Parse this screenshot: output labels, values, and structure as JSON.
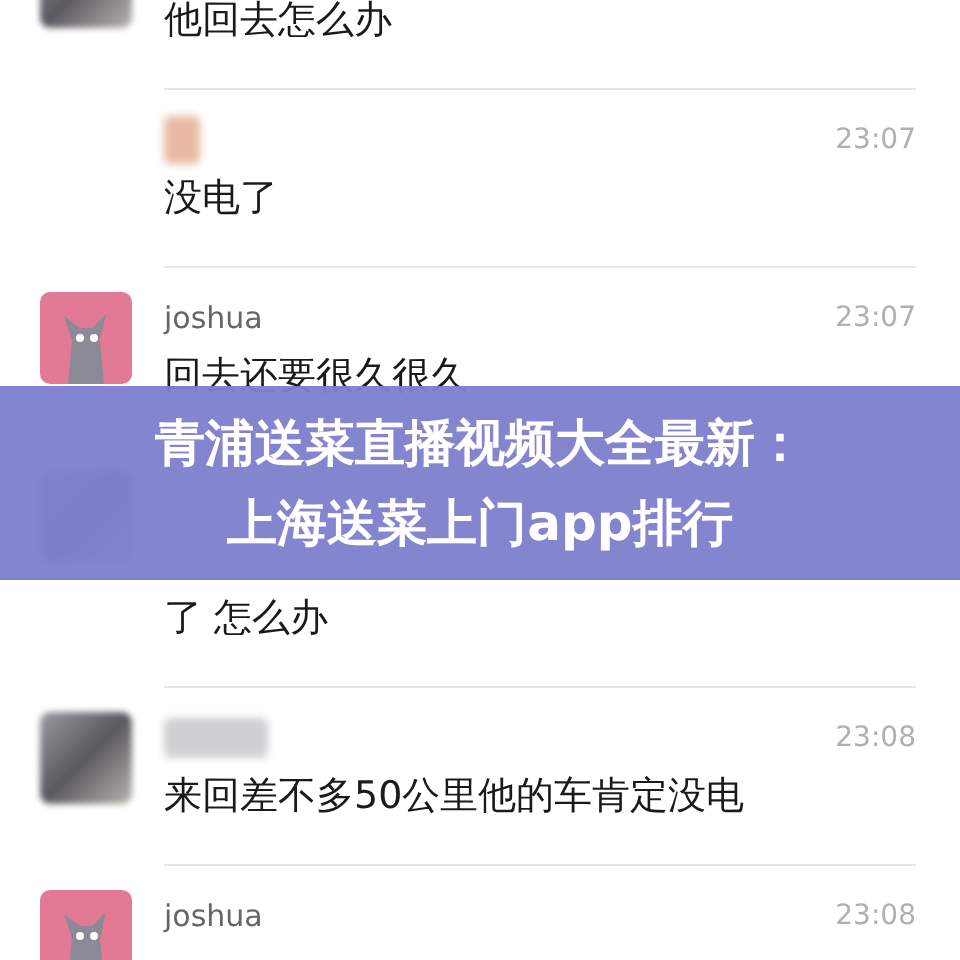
{
  "messages": [
    {
      "avatar": {
        "kind": "blurred"
      },
      "name": {
        "kind": "none"
      },
      "text": "他回去怎么办"
    },
    {
      "avatar": {
        "kind": "none"
      },
      "name": {
        "kind": "image"
      },
      "time": "23:07",
      "text": "没电了"
    },
    {
      "avatar": {
        "kind": "cartoon"
      },
      "name": {
        "kind": "text",
        "text": "joshua"
      },
      "time": "23:07",
      "text": "回去还要很久很久"
    },
    {
      "avatar": {
        "kind": "blurred"
      },
      "name": {
        "kind": "blurred"
      },
      "covered_by_banner": true,
      "text": "了 怎么办"
    },
    {
      "avatar": {
        "kind": "blurred"
      },
      "name": {
        "kind": "blurred"
      },
      "time": "23:08",
      "text": "来回差不多50公里他的车肯定没电"
    },
    {
      "avatar": {
        "kind": "cartoon"
      },
      "name": {
        "kind": "text",
        "text": "joshua"
      },
      "time": "23:08"
    }
  ],
  "overlay_banner": {
    "lines": [
      "青浦送菜直播视频大全最新：",
      "上海送菜上门app排行"
    ]
  }
}
